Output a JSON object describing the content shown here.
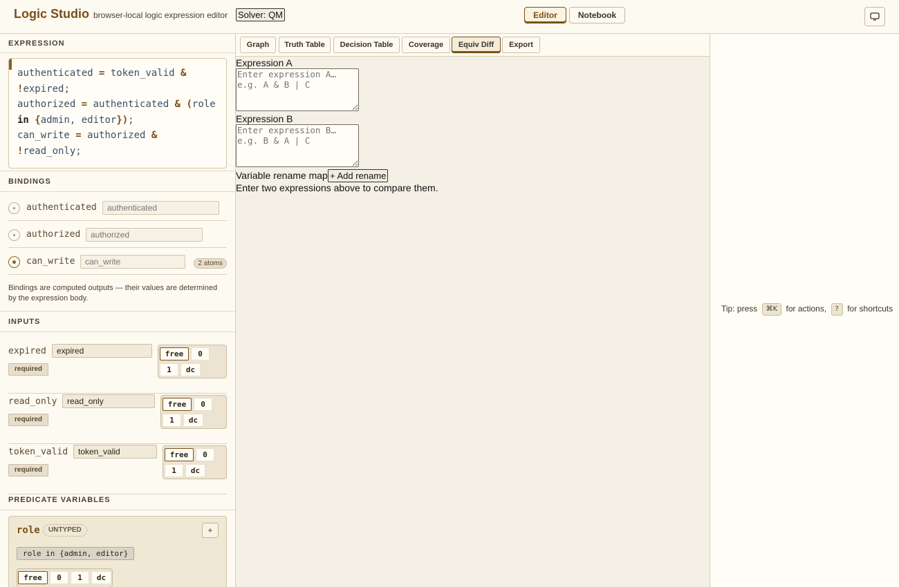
{
  "header": {
    "title": "Logic Studio",
    "subtitle": "browser-local logic expression editor",
    "solver_label": "Solver: QM",
    "modes": [
      {
        "label": "Editor",
        "active": true
      },
      {
        "label": "Notebook",
        "active": false
      }
    ],
    "monitor_icon": "monitor-icon"
  },
  "sidebar": {
    "expression_title": "EXPRESSION",
    "expression_lines": [
      "authenticated = token_valid &",
      "!expired;",
      "authorized = authenticated & (role",
      "in {admin, editor});",
      "can_write = authorized &",
      "!read_only;"
    ],
    "bindings_title": "BINDINGS",
    "bindings": [
      {
        "name": "authenticated",
        "placeholder": "authenticated",
        "selected": false,
        "badge": ""
      },
      {
        "name": "authorized",
        "placeholder": "authorized",
        "selected": false,
        "badge": ""
      },
      {
        "name": "can_write",
        "placeholder": "can_write",
        "selected": true,
        "badge": "2 atoms"
      }
    ],
    "bindings_note": "Bindings are computed outputs — their values are determined by the expression body.",
    "inputs_title": "INPUTS",
    "inputs": [
      {
        "name": "expired",
        "value": "expired",
        "required_label": "required",
        "options": [
          "free",
          "0",
          "1",
          "dc"
        ],
        "selected": "free"
      },
      {
        "name": "read_only",
        "value": "read_only",
        "required_label": "required",
        "options": [
          "free",
          "0",
          "1",
          "dc"
        ],
        "selected": "free"
      },
      {
        "name": "token_valid",
        "value": "token_valid",
        "required_label": "required",
        "options": [
          "free",
          "0",
          "1",
          "dc"
        ],
        "selected": "free"
      }
    ],
    "predicate_title": "PREDICATE VARIABLES",
    "predicate": {
      "name": "role",
      "type_badge": "UNTYPED",
      "add_label": "+",
      "expression": "role in {admin, editor}",
      "options": [
        "free",
        "0",
        "1",
        "dc"
      ],
      "selected": "free"
    }
  },
  "main": {
    "tabs": [
      {
        "label": "Graph",
        "active": false
      },
      {
        "label": "Truth Table",
        "active": false
      },
      {
        "label": "Decision Table",
        "active": false
      },
      {
        "label": "Coverage",
        "active": false
      },
      {
        "label": "Equiv Diff",
        "active": true
      },
      {
        "label": "Export",
        "active": false
      }
    ],
    "expr_a_label": "Expression A",
    "expr_a_placeholder": "Enter expression A… e.g. A & B | C",
    "expr_b_label": "Expression B",
    "expr_b_placeholder": "Enter expression B… e.g. B & A | C",
    "rename_label": "Variable rename map",
    "add_rename_label": "+ Add rename",
    "status_text": "Enter two expressions above to compare them."
  },
  "right_panel": {
    "tip_prefix": "Tip: press",
    "tip_key1": "⌘K",
    "tip_mid": "for actions,",
    "tip_key2": "?",
    "tip_suffix": "for shortcuts"
  }
}
